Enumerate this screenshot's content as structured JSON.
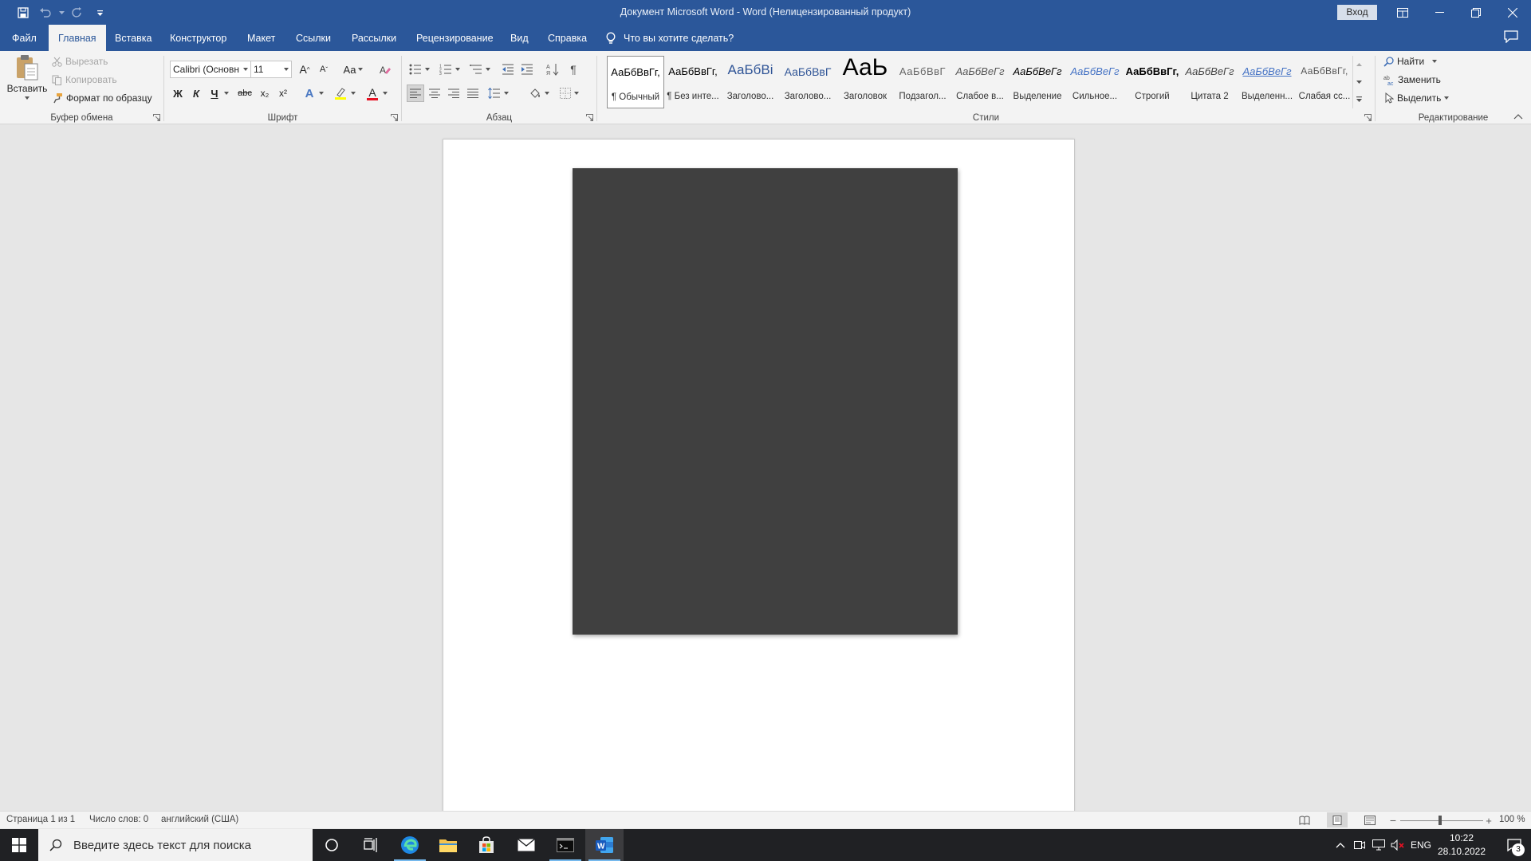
{
  "titlebar": {
    "title": "Документ Microsoft Word  -  Word (Нелицензированный продукт)",
    "signin": "Вход"
  },
  "tabs": [
    {
      "label": "Файл"
    },
    {
      "label": "Главная"
    },
    {
      "label": "Вставка"
    },
    {
      "label": "Конструктор"
    },
    {
      "label": "Макет"
    },
    {
      "label": "Ссылки"
    },
    {
      "label": "Рассылки"
    },
    {
      "label": "Рецензирование"
    },
    {
      "label": "Вид"
    },
    {
      "label": "Справка"
    }
  ],
  "active_tab": "Главная",
  "tellme": "Что вы хотите сделать?",
  "clipboard": {
    "paste": "Вставить",
    "cut": "Вырезать",
    "copy": "Копировать",
    "format_painter": "Формат по образцу",
    "label": "Буфер обмена"
  },
  "font": {
    "name": "Calibri (Основн",
    "size": "11",
    "case_label": "Aa",
    "bold": "Ж",
    "italic": "К",
    "underline": "Ч",
    "strike": "abc",
    "subscript": "x₂",
    "superscript": "x²",
    "effects": "A",
    "color_letter": "A",
    "grow": "A",
    "shrink": "A",
    "label": "Шрифт"
  },
  "paragraph": {
    "label": "Абзац"
  },
  "styles": {
    "label": "Стили",
    "items": [
      {
        "preview": "АаБбВвГг,",
        "name": "¶ Обычный"
      },
      {
        "preview": "АаБбВвГг,",
        "name": "¶ Без инте..."
      },
      {
        "preview": "АаБбВі",
        "name": "Заголово..."
      },
      {
        "preview": "АаБбВвГ",
        "name": "Заголово..."
      },
      {
        "preview": "АаЬ",
        "name": "Заголовок"
      },
      {
        "preview": "АаБбВвГ",
        "name": "Подзагол..."
      },
      {
        "preview": "АаБбВеГг",
        "name": "Слабое в..."
      },
      {
        "preview": "АаБбВеГг",
        "name": "Выделение"
      },
      {
        "preview": "АаБбВеГг",
        "name": "Сильное..."
      },
      {
        "preview": "АаБбВвГг,",
        "name": "Строгий"
      },
      {
        "preview": "АаБбВеГг",
        "name": "Цитата 2"
      },
      {
        "preview": "АаБбВеГг",
        "name": "Выделенн..."
      },
      {
        "preview": "АаБбВвГг,",
        "name": "Слабая сс..."
      }
    ]
  },
  "editing": {
    "label": "Редактирование",
    "find": "Найти",
    "replace": "Заменить",
    "select": "Выделить"
  },
  "statusbar": {
    "page": "Страница 1 из 1",
    "words": "Число слов: 0",
    "language": "английский (США)",
    "zoom": "100 %"
  },
  "taskbar": {
    "search_placeholder": "Введите здесь текст для поиска",
    "lang": "ENG",
    "time": "10:22",
    "date": "28.10.2022",
    "notifications": "3"
  },
  "colors": {
    "accent": "#2b579a",
    "ribbon_bg": "#f3f3f3",
    "canvas_bg": "#e6e6e6",
    "picture": "#404040",
    "font_color_bar": "#e81123",
    "highlight_bar": "#ffff00"
  }
}
